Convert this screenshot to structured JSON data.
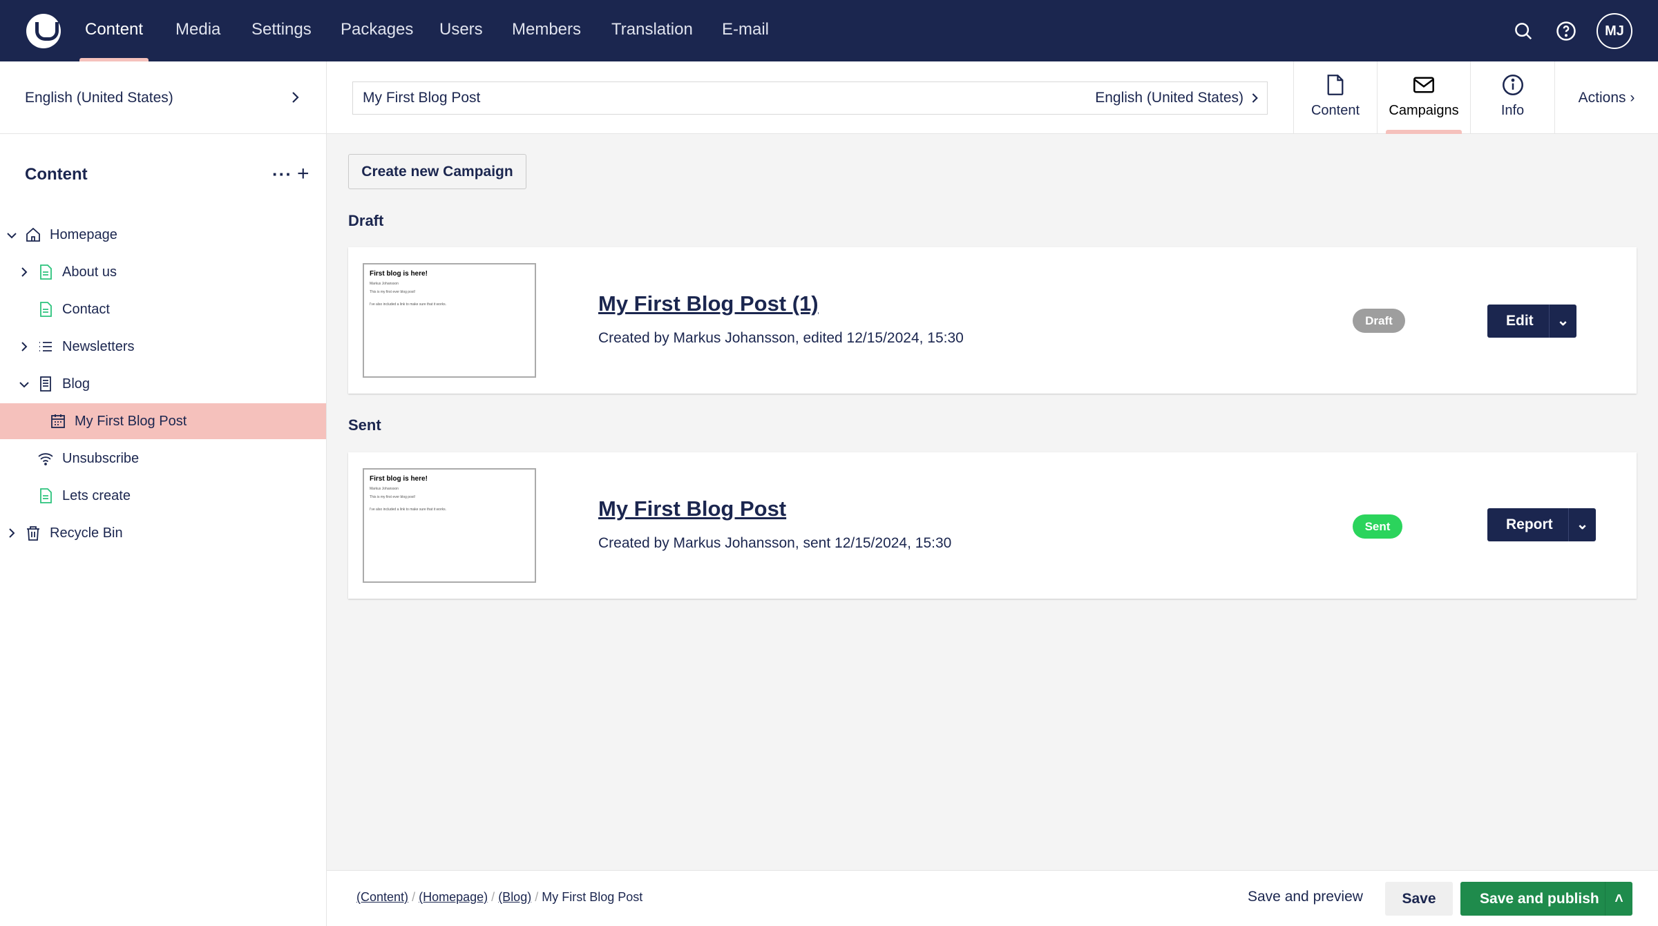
{
  "topnav": {
    "items": [
      "Content",
      "Media",
      "Settings",
      "Packages",
      "Users",
      "Members",
      "Translation",
      "E-mail"
    ],
    "active": "Content",
    "avatar": "MJ"
  },
  "sidebar": {
    "language": "English (United States)",
    "heading": "Content",
    "tree": [
      {
        "label": "Homepage",
        "icon": "home-icon",
        "level": 0,
        "expander": "expanded"
      },
      {
        "label": "About us",
        "icon": "document-icon",
        "level": 1,
        "expander": "collapsed"
      },
      {
        "label": "Contact",
        "icon": "document-icon",
        "level": 1,
        "expander": "none"
      },
      {
        "label": "Newsletters",
        "icon": "list-icon",
        "level": 1,
        "expander": "collapsed"
      },
      {
        "label": "Blog",
        "icon": "blog-icon",
        "level": 1,
        "expander": "expanded"
      },
      {
        "label": "My First Blog Post",
        "icon": "calendar-icon",
        "level": 2,
        "expander": "none",
        "selected": true
      },
      {
        "label": "Unsubscribe",
        "icon": "wifi-icon",
        "level": 1,
        "expander": "none"
      },
      {
        "label": "Lets create",
        "icon": "document-icon",
        "level": 1,
        "expander": "none"
      },
      {
        "label": "Recycle Bin",
        "icon": "trash-icon",
        "level": 0,
        "expander": "collapsed"
      }
    ]
  },
  "editor": {
    "name": "My First Blog Post",
    "language": "English (United States)",
    "tabs": [
      "Content",
      "Campaigns",
      "Info"
    ],
    "active_tab": "Campaigns",
    "actions": "Actions"
  },
  "campaigns": {
    "create_label": "Create new Campaign",
    "draft": {
      "heading": "Draft",
      "title": "My First Blog Post (1)",
      "subtitle": "Created by Markus Johansson, edited 12/15/2024, 15:30",
      "badge": "Draft",
      "button": "Edit"
    },
    "sent": {
      "heading": "Sent",
      "title": "My First Blog Post",
      "subtitle": "Created by Markus Johansson, sent 12/15/2024, 15:30",
      "badge": "Sent",
      "button": "Report"
    },
    "thumbnail": {
      "title": "First blog is here!",
      "author": "Markus Johansson",
      "line1": "This is my first ever blog post!",
      "line2": "I've also included a link to make sure that it works."
    }
  },
  "footer": {
    "breadcrumb": [
      "(Content)",
      "(Homepage)",
      "(Blog)",
      "My First Blog Post"
    ],
    "save_preview": "Save and preview",
    "save": "Save",
    "save_publish": "Save and publish"
  },
  "colors": {
    "header": "#1b264f",
    "highlight": "#f5c1bc",
    "draft_badge": "#9e9e9e",
    "sent_badge": "#2bd45c",
    "publish": "#1f8b4c"
  }
}
